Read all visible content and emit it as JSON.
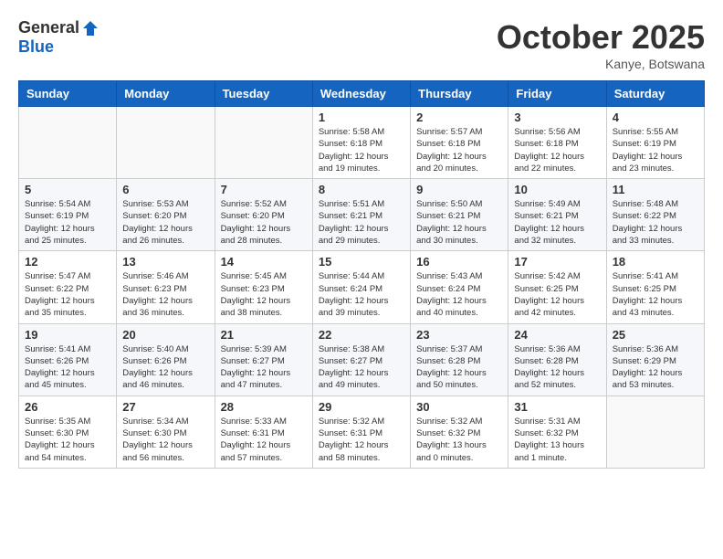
{
  "header": {
    "logo_general": "General",
    "logo_blue": "Blue",
    "month_title": "October 2025",
    "location": "Kanye, Botswana"
  },
  "calendar": {
    "days_of_week": [
      "Sunday",
      "Monday",
      "Tuesday",
      "Wednesday",
      "Thursday",
      "Friday",
      "Saturday"
    ],
    "weeks": [
      [
        {
          "day": "",
          "info": ""
        },
        {
          "day": "",
          "info": ""
        },
        {
          "day": "",
          "info": ""
        },
        {
          "day": "1",
          "info": "Sunrise: 5:58 AM\nSunset: 6:18 PM\nDaylight: 12 hours\nand 19 minutes."
        },
        {
          "day": "2",
          "info": "Sunrise: 5:57 AM\nSunset: 6:18 PM\nDaylight: 12 hours\nand 20 minutes."
        },
        {
          "day": "3",
          "info": "Sunrise: 5:56 AM\nSunset: 6:18 PM\nDaylight: 12 hours\nand 22 minutes."
        },
        {
          "day": "4",
          "info": "Sunrise: 5:55 AM\nSunset: 6:19 PM\nDaylight: 12 hours\nand 23 minutes."
        }
      ],
      [
        {
          "day": "5",
          "info": "Sunrise: 5:54 AM\nSunset: 6:19 PM\nDaylight: 12 hours\nand 25 minutes."
        },
        {
          "day": "6",
          "info": "Sunrise: 5:53 AM\nSunset: 6:20 PM\nDaylight: 12 hours\nand 26 minutes."
        },
        {
          "day": "7",
          "info": "Sunrise: 5:52 AM\nSunset: 6:20 PM\nDaylight: 12 hours\nand 28 minutes."
        },
        {
          "day": "8",
          "info": "Sunrise: 5:51 AM\nSunset: 6:21 PM\nDaylight: 12 hours\nand 29 minutes."
        },
        {
          "day": "9",
          "info": "Sunrise: 5:50 AM\nSunset: 6:21 PM\nDaylight: 12 hours\nand 30 minutes."
        },
        {
          "day": "10",
          "info": "Sunrise: 5:49 AM\nSunset: 6:21 PM\nDaylight: 12 hours\nand 32 minutes."
        },
        {
          "day": "11",
          "info": "Sunrise: 5:48 AM\nSunset: 6:22 PM\nDaylight: 12 hours\nand 33 minutes."
        }
      ],
      [
        {
          "day": "12",
          "info": "Sunrise: 5:47 AM\nSunset: 6:22 PM\nDaylight: 12 hours\nand 35 minutes."
        },
        {
          "day": "13",
          "info": "Sunrise: 5:46 AM\nSunset: 6:23 PM\nDaylight: 12 hours\nand 36 minutes."
        },
        {
          "day": "14",
          "info": "Sunrise: 5:45 AM\nSunset: 6:23 PM\nDaylight: 12 hours\nand 38 minutes."
        },
        {
          "day": "15",
          "info": "Sunrise: 5:44 AM\nSunset: 6:24 PM\nDaylight: 12 hours\nand 39 minutes."
        },
        {
          "day": "16",
          "info": "Sunrise: 5:43 AM\nSunset: 6:24 PM\nDaylight: 12 hours\nand 40 minutes."
        },
        {
          "day": "17",
          "info": "Sunrise: 5:42 AM\nSunset: 6:25 PM\nDaylight: 12 hours\nand 42 minutes."
        },
        {
          "day": "18",
          "info": "Sunrise: 5:41 AM\nSunset: 6:25 PM\nDaylight: 12 hours\nand 43 minutes."
        }
      ],
      [
        {
          "day": "19",
          "info": "Sunrise: 5:41 AM\nSunset: 6:26 PM\nDaylight: 12 hours\nand 45 minutes."
        },
        {
          "day": "20",
          "info": "Sunrise: 5:40 AM\nSunset: 6:26 PM\nDaylight: 12 hours\nand 46 minutes."
        },
        {
          "day": "21",
          "info": "Sunrise: 5:39 AM\nSunset: 6:27 PM\nDaylight: 12 hours\nand 47 minutes."
        },
        {
          "day": "22",
          "info": "Sunrise: 5:38 AM\nSunset: 6:27 PM\nDaylight: 12 hours\nand 49 minutes."
        },
        {
          "day": "23",
          "info": "Sunrise: 5:37 AM\nSunset: 6:28 PM\nDaylight: 12 hours\nand 50 minutes."
        },
        {
          "day": "24",
          "info": "Sunrise: 5:36 AM\nSunset: 6:28 PM\nDaylight: 12 hours\nand 52 minutes."
        },
        {
          "day": "25",
          "info": "Sunrise: 5:36 AM\nSunset: 6:29 PM\nDaylight: 12 hours\nand 53 minutes."
        }
      ],
      [
        {
          "day": "26",
          "info": "Sunrise: 5:35 AM\nSunset: 6:30 PM\nDaylight: 12 hours\nand 54 minutes."
        },
        {
          "day": "27",
          "info": "Sunrise: 5:34 AM\nSunset: 6:30 PM\nDaylight: 12 hours\nand 56 minutes."
        },
        {
          "day": "28",
          "info": "Sunrise: 5:33 AM\nSunset: 6:31 PM\nDaylight: 12 hours\nand 57 minutes."
        },
        {
          "day": "29",
          "info": "Sunrise: 5:32 AM\nSunset: 6:31 PM\nDaylight: 12 hours\nand 58 minutes."
        },
        {
          "day": "30",
          "info": "Sunrise: 5:32 AM\nSunset: 6:32 PM\nDaylight: 13 hours\nand 0 minutes."
        },
        {
          "day": "31",
          "info": "Sunrise: 5:31 AM\nSunset: 6:32 PM\nDaylight: 13 hours\nand 1 minute."
        },
        {
          "day": "",
          "info": ""
        }
      ]
    ]
  }
}
